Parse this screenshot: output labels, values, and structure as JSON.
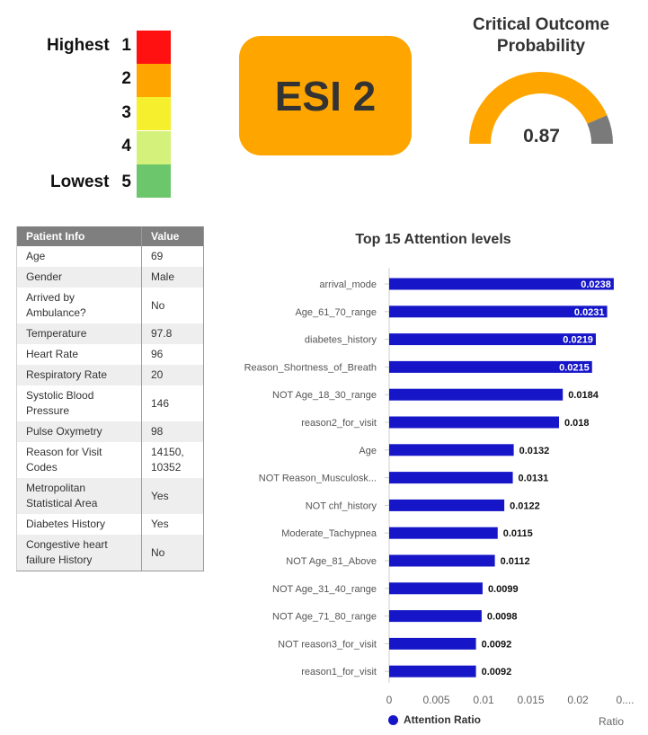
{
  "scale": {
    "highest_label": "Highest",
    "lowest_label": "Lowest",
    "levels": [
      {
        "num": "1",
        "color": "#ff1111"
      },
      {
        "num": "2",
        "color": "#ffa500"
      },
      {
        "num": "3",
        "color": "#f5ef2e"
      },
      {
        "num": "4",
        "color": "#d4f27b"
      },
      {
        "num": "5",
        "color": "#6cc76c"
      }
    ]
  },
  "esi": {
    "label": "ESI 2",
    "color": "#ffa500"
  },
  "gauge": {
    "title_line1": "Critical Outcome",
    "title_line2": "Probability",
    "value": 0.87,
    "value_label": "0.87",
    "fill_color": "#ffa500",
    "rest_color": "#7a7a7a"
  },
  "patient_table": {
    "headers": [
      "Patient Info",
      "Value"
    ],
    "rows": [
      [
        "Age",
        "69"
      ],
      [
        "Gender",
        "Male"
      ],
      [
        "Arrived by Ambulance?",
        "No"
      ],
      [
        "Temperature",
        "97.8"
      ],
      [
        "Heart Rate",
        "96"
      ],
      [
        "Respiratory Rate",
        "20"
      ],
      [
        "Systolic Blood Pressure",
        "146"
      ],
      [
        "Pulse Oxymetry",
        "98"
      ],
      [
        "Reason for Visit Codes",
        "14150, 10352"
      ],
      [
        "Metropolitan Statistical Area",
        "Yes"
      ],
      [
        "Diabetes History",
        "Yes"
      ],
      [
        "Congestive heart failure History",
        "No"
      ]
    ]
  },
  "chart_data": {
    "type": "bar",
    "orientation": "horizontal",
    "title": "Top 15 Attention levels",
    "xlabel": "Ratio",
    "xlim": [
      0,
      0.024
    ],
    "x_ticks": [
      "0",
      "0.005",
      "0.01",
      "0.015",
      "0.02",
      "0...."
    ],
    "legend_position": "bottom",
    "series": [
      {
        "name": "Attention Ratio",
        "color": "#1616c8",
        "categories": [
          "arrival_mode",
          "Age_61_70_range",
          "diabetes_history",
          "Reason_Shortness_of_Breath",
          "NOT Age_18_30_range",
          "reason2_for_visit",
          "Age",
          "NOT Reason_Musculosk...",
          "NOT chf_history",
          "Moderate_Tachypnea",
          "NOT Age_81_Above",
          "NOT Age_31_40_range",
          "NOT Age_71_80_range",
          "NOT reason3_for_visit",
          "reason1_for_visit"
        ],
        "values": [
          0.0238,
          0.0231,
          0.0219,
          0.0215,
          0.0184,
          0.018,
          0.0132,
          0.0131,
          0.0122,
          0.0115,
          0.0112,
          0.0099,
          0.0098,
          0.0092,
          0.0092
        ],
        "value_labels": [
          "0.0238",
          "0.0231",
          "0.0219",
          "0.0215",
          "0.0184",
          "0.018",
          "0.0132",
          "0.0131",
          "0.0122",
          "0.0115",
          "0.0112",
          "0.0099",
          "0.0098",
          "0.0092",
          "0.0092"
        ]
      }
    ]
  }
}
